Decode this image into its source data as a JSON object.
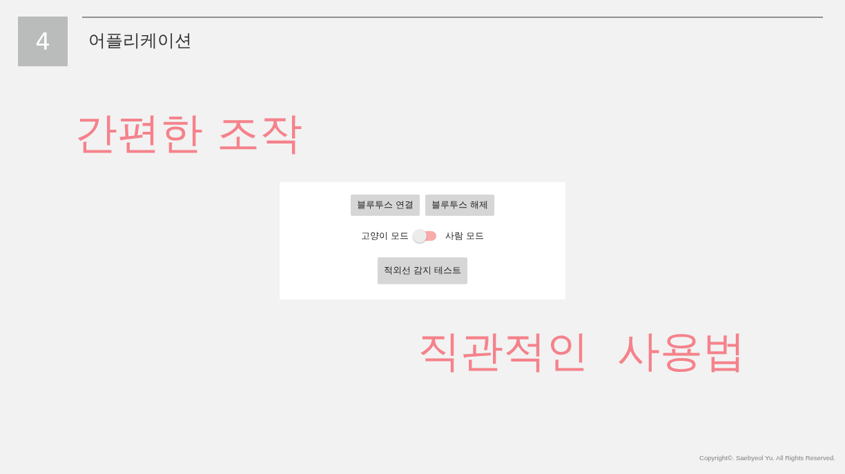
{
  "slide_header": {
    "number": "4",
    "title": "어플리케이션"
  },
  "caption_1": "간편한 조작",
  "app_screen": {
    "buttons": [
      {
        "label": "블루투스 연결"
      },
      {
        "label": "블루투스 해제"
      }
    ],
    "mode_switch": {
      "left_label": "고양이 모드",
      "on": false,
      "right_label": "사람 모드"
    },
    "test_button": {
      "label": "적외선 감지 테스트"
    }
  },
  "caption_2": "직관적인 사용법",
  "footer": "Copyright©. Saebyeol Yu. All Rights Reserved."
}
